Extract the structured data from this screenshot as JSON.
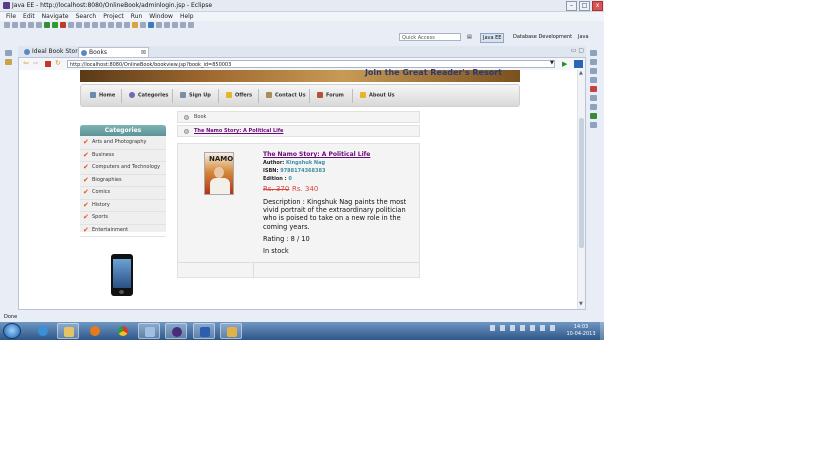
{
  "window": {
    "title": "Java EE - http://localhost:8080/OnlineBook/adminlogin.jsp - Eclipse",
    "buttons": [
      "–",
      "□",
      "x"
    ]
  },
  "menubar": [
    "File",
    "Edit",
    "Navigate",
    "Search",
    "Project",
    "Run",
    "Window",
    "Help"
  ],
  "quick_access": {
    "placeholder": "Quick Access"
  },
  "perspectives": {
    "javaee": "Java EE",
    "database": "Database Development",
    "java": "Java"
  },
  "tabs": [
    {
      "label": "Ideal Book Store",
      "active": false
    },
    {
      "label": "Books",
      "active": true,
      "close": "⊠"
    }
  ],
  "browser": {
    "url": "http://localhost:8080/OnlineBook/bookview.jsp?book_id=850003"
  },
  "banner": {
    "text": "Join the Great Reader's Resort"
  },
  "site_nav": [
    "Home",
    "Categories",
    "Sign Up",
    "Offers",
    "Contact Us",
    "Forum",
    "About Us"
  ],
  "categories": {
    "title": "Categories",
    "items": [
      "Arts and Photography",
      "Business",
      "Computers and Technology",
      "Biographies",
      "Comics",
      "History",
      "Sports",
      "Entertainment"
    ]
  },
  "breadcrumb": {
    "section": "Book",
    "title": "The Namo Story: A Political Life"
  },
  "book": {
    "title": "The Namo Story: A Political Life",
    "cover_text": "NAMO",
    "author_label": "Author:",
    "author": "Kingshuk Nag",
    "isbn_label": "ISBN:",
    "isbn": "9788174368383",
    "edition_label": "Edition :",
    "edition": "0",
    "price_old": "Rs. 370",
    "price_new": "Rs. 340",
    "description": "Description : Kingshuk Nag paints the most vivid portrait of the extraordinary politician who is poised to take on a new role in the coming years.",
    "rating": "Rating : 8 / 10",
    "stock": "In stock"
  },
  "status": {
    "text": "Done"
  },
  "taskbar": {
    "time": "14:03",
    "date": "10-04-2013"
  },
  "colors": {
    "accent": "#6b0a7a",
    "price": "#d9453c",
    "category_head": "#5d9396",
    "check": "#e8531f"
  }
}
